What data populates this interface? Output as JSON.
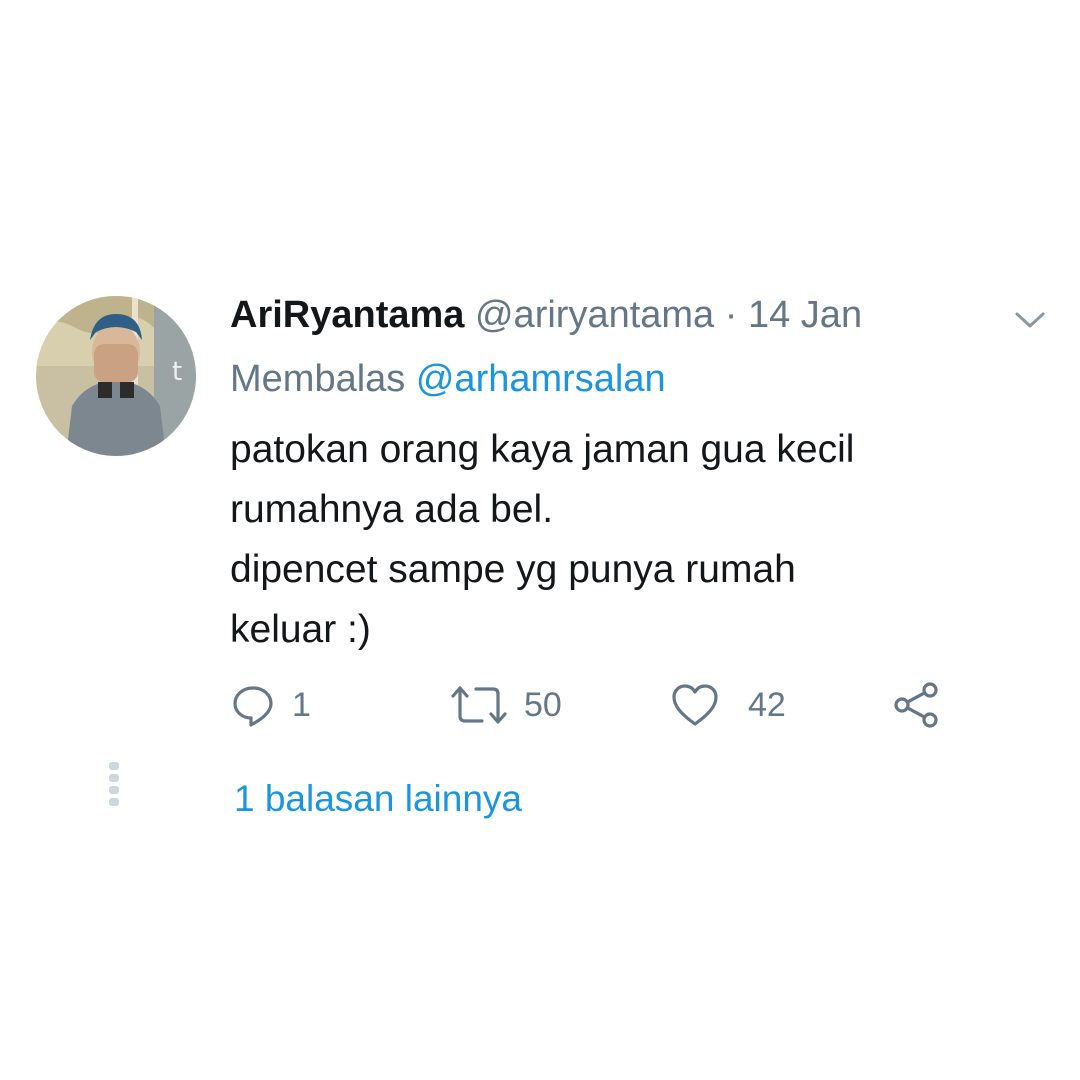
{
  "tweet": {
    "display_name": "AriRyantama",
    "handle": "@ariryantama",
    "separator": "·",
    "date": "14 Jan",
    "reply_prefix": "Membalas",
    "reply_to": "@arhamrsalan",
    "text_lines": [
      "patokan orang kaya jaman gua kecil",
      "rumahnya ada bel.",
      "dipencet sampe yg punya rumah",
      "keluar :)"
    ],
    "actions": {
      "reply": {
        "icon": "reply-icon",
        "count": "1"
      },
      "retweet": {
        "icon": "retweet-icon",
        "count": "50"
      },
      "like": {
        "icon": "heart-icon",
        "count": "42"
      },
      "share": {
        "icon": "share-icon"
      }
    },
    "more_replies_label": "1 balasan lainnya"
  },
  "colors": {
    "text_primary": "#14171a",
    "text_secondary": "#657786",
    "link": "#1b95e0",
    "thread_line": "#ccd6dd"
  }
}
